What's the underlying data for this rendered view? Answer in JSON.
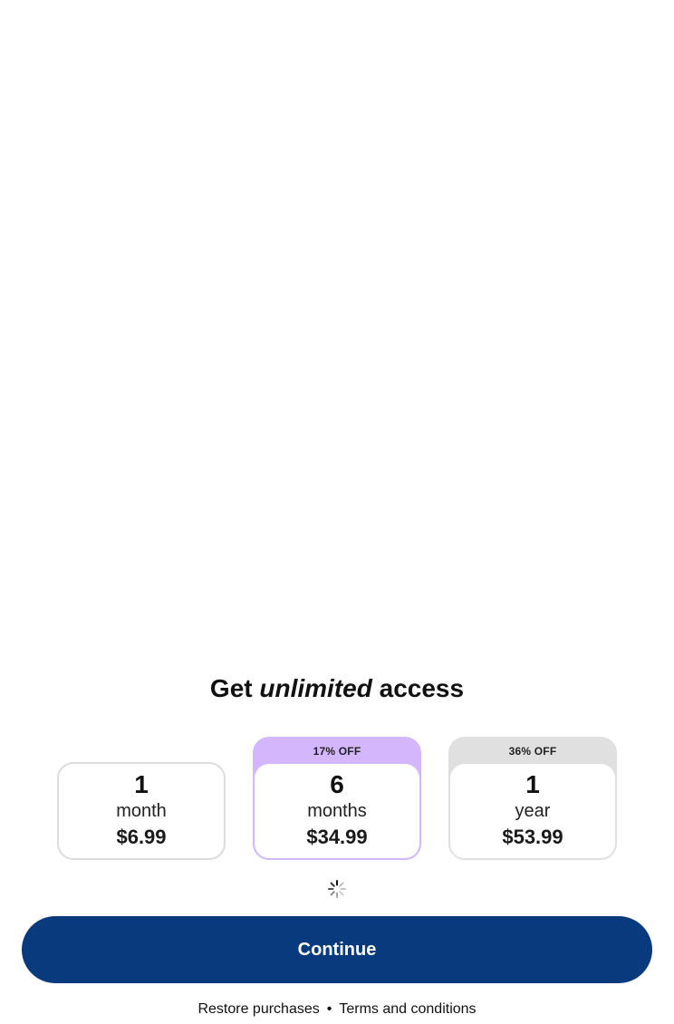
{
  "headline": {
    "pre": "Get ",
    "emphasis": "unlimited",
    "post": " access"
  },
  "plans": [
    {
      "badge": "",
      "quantity": "1",
      "unit": "month",
      "price": "$6.99",
      "selected": false
    },
    {
      "badge": "17% OFF",
      "quantity": "6",
      "unit": "months",
      "price": "$34.99",
      "selected": true
    },
    {
      "badge": "36% OFF",
      "quantity": "1",
      "unit": "year",
      "price": "$53.99",
      "selected": false
    }
  ],
  "colors": {
    "selected_plan": "#d3b6fb",
    "badge_gray": "#e0e0e0",
    "primary_button": "#093a7d"
  },
  "loading_icon": "spinner-icon",
  "continue_label": "Continue",
  "footer": {
    "restore_label": "Restore purchases",
    "separator": "•",
    "terms_label": "Terms and conditions"
  }
}
